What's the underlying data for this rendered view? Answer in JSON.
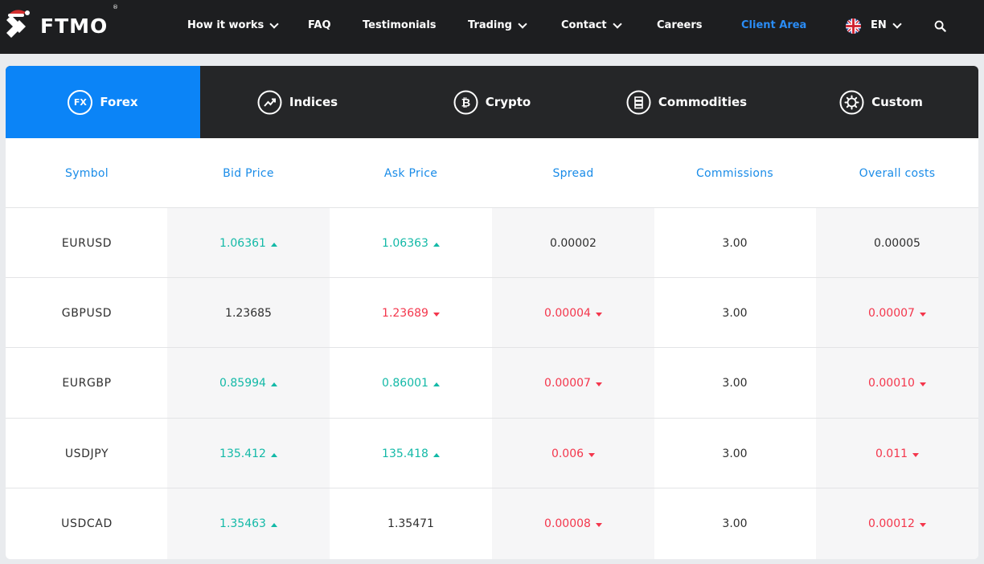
{
  "nav": {
    "logo_text": "FTMO",
    "logo_reg": "®",
    "items": [
      {
        "label": "How it works"
      },
      {
        "label": "FAQ"
      },
      {
        "label": "Testimonials"
      },
      {
        "label": "Trading"
      },
      {
        "label": "Contact"
      },
      {
        "label": "Careers"
      },
      {
        "label": "Client Area"
      }
    ],
    "language": "EN"
  },
  "tabs": [
    {
      "label": "Forex",
      "icon_text": "FX",
      "icon": "fx-icon"
    },
    {
      "label": "Indices",
      "icon": "trend-up-icon"
    },
    {
      "label": "Crypto",
      "icon": "bitcoin-icon"
    },
    {
      "label": "Commodities",
      "icon": "gold-bars-icon"
    },
    {
      "label": "Custom",
      "icon": "gear-icon"
    }
  ],
  "table": {
    "headers": [
      "Symbol",
      "Bid Price",
      "Ask Price",
      "Spread",
      "Commissions",
      "Overall costs"
    ],
    "rows": [
      {
        "symbol": "EURUSD",
        "bid": "1.06361",
        "bid_dir": "up",
        "ask": "1.06363",
        "ask_dir": "up",
        "spread": "0.00002",
        "spread_dir": "",
        "commission": "3.00",
        "overall": "0.00005",
        "overall_dir": ""
      },
      {
        "symbol": "GBPUSD",
        "bid": "1.23685",
        "bid_dir": "",
        "ask": "1.23689",
        "ask_dir": "down",
        "spread": "0.00004",
        "spread_dir": "down",
        "commission": "3.00",
        "overall": "0.00007",
        "overall_dir": "down"
      },
      {
        "symbol": "EURGBP",
        "bid": "0.85994",
        "bid_dir": "up",
        "ask": "0.86001",
        "ask_dir": "up",
        "spread": "0.00007",
        "spread_dir": "down",
        "commission": "3.00",
        "overall": "0.00010",
        "overall_dir": "down"
      },
      {
        "symbol": "USDJPY",
        "bid": "135.412",
        "bid_dir": "up",
        "ask": "135.418",
        "ask_dir": "up",
        "spread": "0.006",
        "spread_dir": "down",
        "commission": "3.00",
        "overall": "0.011",
        "overall_dir": "down"
      },
      {
        "symbol": "USDCAD",
        "bid": "1.35463",
        "bid_dir": "up",
        "ask": "1.35471",
        "ask_dir": "",
        "spread": "0.00008",
        "spread_dir": "down",
        "commission": "3.00",
        "overall": "0.00012",
        "overall_dir": "down"
      }
    ]
  },
  "colors": {
    "accent": "#0b84f7",
    "up": "#13b9a7",
    "down": "#f4364c",
    "header_text": "#1a8ce8"
  }
}
